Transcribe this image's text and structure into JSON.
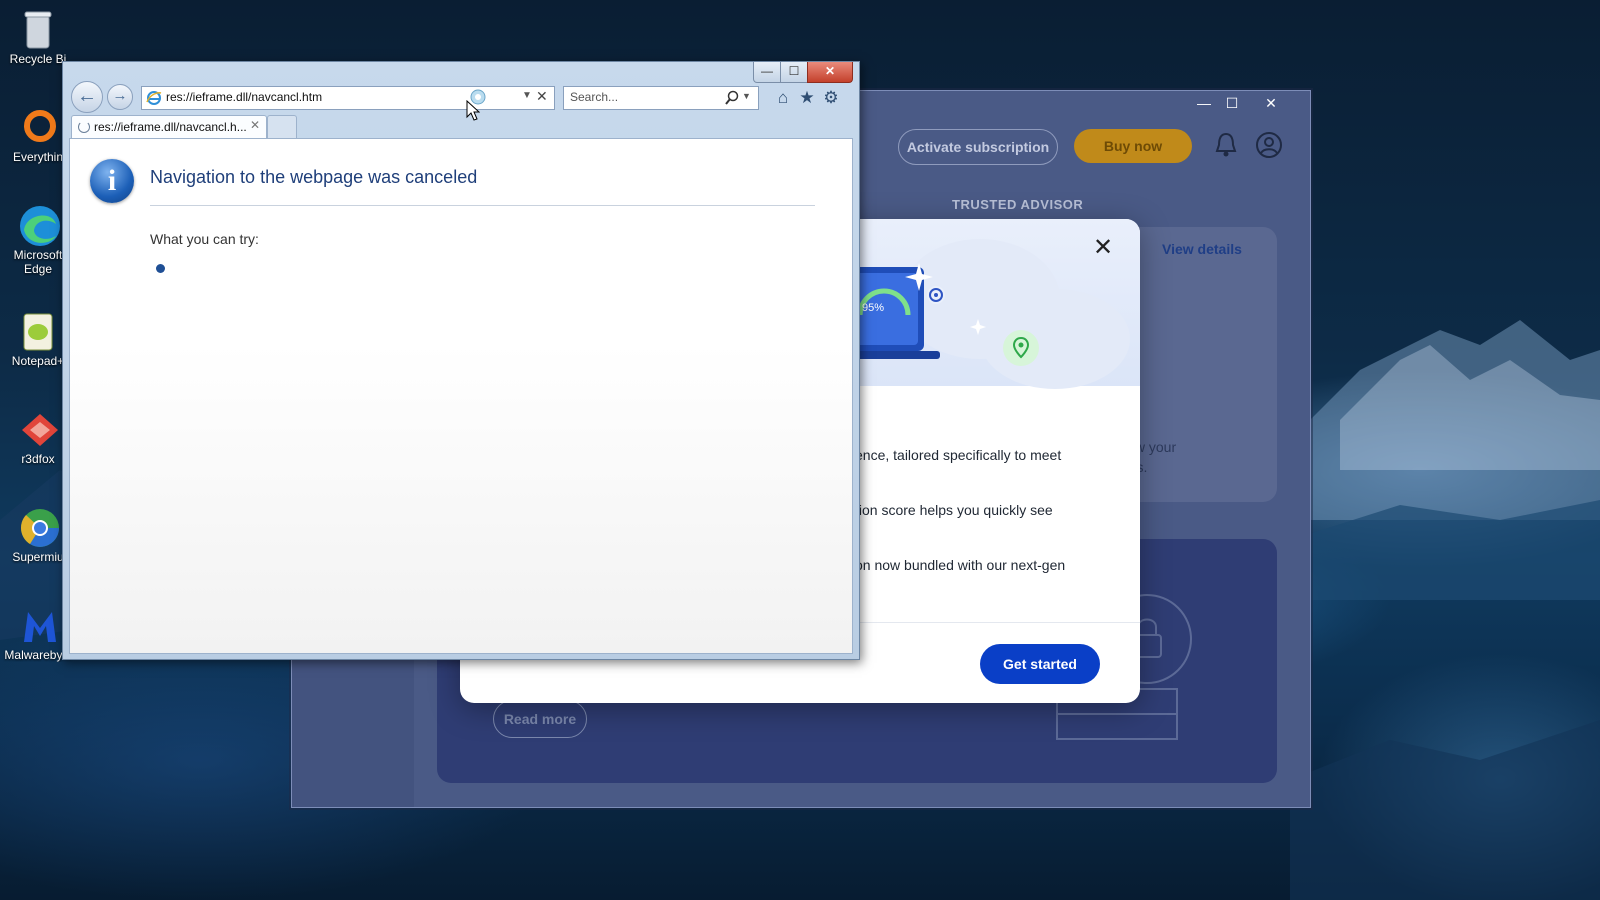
{
  "desktop": {
    "icons": [
      {
        "label": "Recycle Bi",
        "icon": "recycle-bin-icon"
      },
      {
        "label": "Everythin",
        "icon": "everything-search-icon"
      },
      {
        "label": "Microsoft Edge",
        "icon": "edge-icon"
      },
      {
        "label": "Notepad+",
        "icon": "notepad-plus-plus-icon"
      },
      {
        "label": "r3dfox",
        "icon": "r3dfox-icon"
      },
      {
        "label": "Supermiu",
        "icon": "supermium-icon"
      },
      {
        "label": "Malwareby...",
        "icon": "malwarebytes-icon"
      }
    ]
  },
  "background_app": {
    "window_controls": {
      "minimize": "—",
      "maximize": "☐",
      "close": "✕"
    },
    "activate_label": "Activate subscription",
    "buy_label": "Buy now",
    "section_heading": "TRUSTED ADVISOR",
    "view_details": "View details",
    "card_text_1": "view your",
    "card_text_2": "atus.",
    "read_more": "Read more",
    "colors": {
      "buy": "#c08a1a",
      "bg": "#4a5a86"
    }
  },
  "modal": {
    "close_icon": "✕",
    "gauge_text": "95%",
    "lines": [
      "ence, tailored specifically to meet",
      "tion score helps you quickly see",
      "on now bundled with our next-gen"
    ],
    "cta": "Get started",
    "colors": {
      "cta": "#0a3fc7"
    }
  },
  "ie": {
    "window_controls": {
      "minimize": "—",
      "maximize": "☐",
      "close": "✕"
    },
    "address": "res://ieframe.dll/navcancl.htm",
    "search_placeholder": "Search...",
    "tab_title": "res://ieframe.dll/navcancl.h...",
    "page": {
      "title": "Navigation to the webpage was canceled",
      "subtitle": "What you can try:"
    }
  }
}
